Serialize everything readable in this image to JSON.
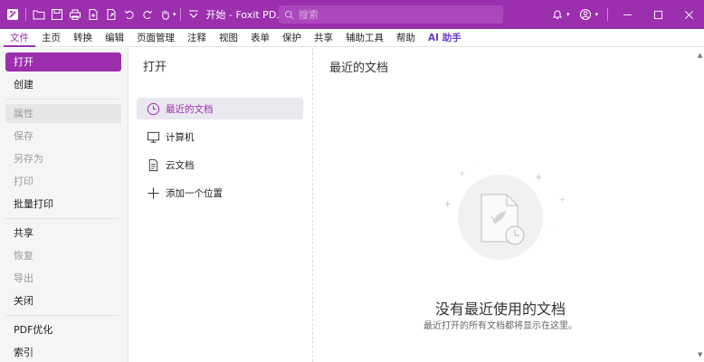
{
  "titlebar": {
    "doc_title": "开始 - Foxit PD...",
    "search_placeholder": "搜索",
    "accent_color": "#9b2fae"
  },
  "menu": {
    "items": [
      "文件",
      "主页",
      "转换",
      "编辑",
      "页面管理",
      "注释",
      "视图",
      "表单",
      "保护",
      "共享",
      "辅助工具",
      "帮助",
      "AI 助手"
    ],
    "active_index": 0
  },
  "leftnav": {
    "items": [
      {
        "label": "打开",
        "state": "selected"
      },
      {
        "label": "创建",
        "state": "normal"
      },
      {
        "label": "属性",
        "state": "disabled"
      },
      {
        "label": "保存",
        "state": "disabled"
      },
      {
        "label": "另存为",
        "state": "disabled"
      },
      {
        "label": "打印",
        "state": "disabled"
      },
      {
        "label": "批量打印",
        "state": "normal"
      },
      {
        "label": "共享",
        "state": "normal"
      },
      {
        "label": "恢复",
        "state": "disabled"
      },
      {
        "label": "导出",
        "state": "disabled"
      },
      {
        "label": "关闭",
        "state": "normal"
      },
      {
        "label": "PDF优化",
        "state": "normal"
      },
      {
        "label": "索引",
        "state": "normal"
      }
    ]
  },
  "open_panel": {
    "title": "打开",
    "locations": [
      {
        "label": "最近的文档",
        "icon": "clock-icon",
        "selected": true
      },
      {
        "label": "计算机",
        "icon": "monitor-icon",
        "selected": false
      },
      {
        "label": "云文档",
        "icon": "document-icon",
        "selected": false
      },
      {
        "label": "添加一个位置",
        "icon": "plus-icon",
        "selected": false
      }
    ]
  },
  "recent": {
    "title": "最近的文档",
    "empty_title": "没有最近使用的文档",
    "empty_subtitle": "最近打开的所有文档都将显示在这里。"
  }
}
